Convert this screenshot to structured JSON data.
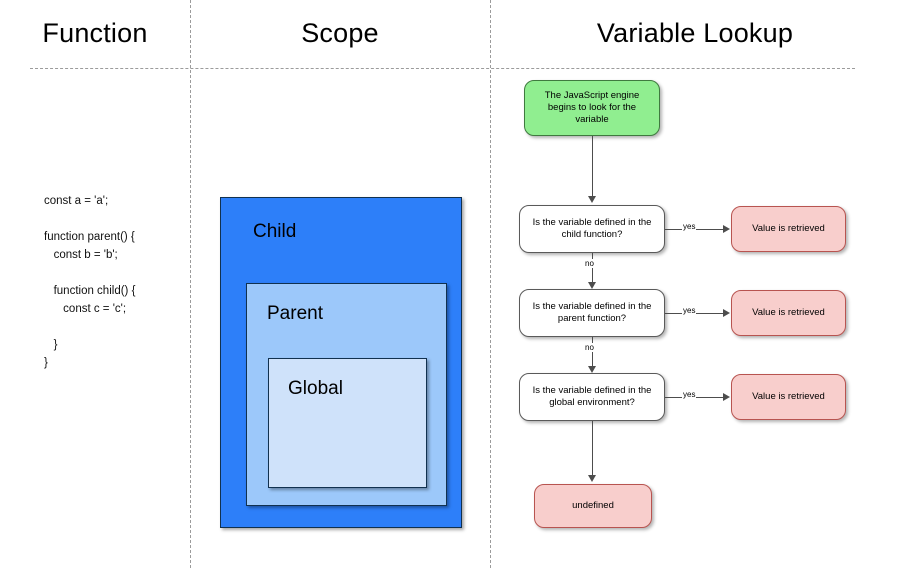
{
  "columns": [
    {
      "id": "function",
      "title": "Function"
    },
    {
      "id": "scope",
      "title": "Scope"
    },
    {
      "id": "lookup",
      "title": "Variable Lookup"
    }
  ],
  "code": {
    "label": "javascript-scope-example",
    "text": "const a = 'a';\n\nfunction parent() {\n   const b = 'b';\n\n   function child() {\n      const c = 'c';\n\n   }\n}"
  },
  "scope_boxes": [
    {
      "id": "child",
      "label": "Child",
      "color": "#2d7ff9"
    },
    {
      "id": "parent",
      "label": "Parent",
      "color": "#9cc8fa"
    },
    {
      "id": "global",
      "label": "Global",
      "color": "#cfe2fa"
    }
  ],
  "flowchart": {
    "start": {
      "id": "start-node",
      "text": "The JavaScript engine begins to look for the variable",
      "color": "#90ee90"
    },
    "decisions": [
      {
        "id": "child-check",
        "text": "Is the variable defined in the child function?",
        "yes_label": "yes",
        "no_label": "no"
      },
      {
        "id": "parent-check",
        "text": "Is the variable defined in the parent function?",
        "yes_label": "yes",
        "no_label": "no"
      },
      {
        "id": "global-check",
        "text": "Is the variable defined in the global environment?",
        "yes_label": "yes",
        "no_label": ""
      }
    ],
    "results": [
      {
        "id": "result-child",
        "text": "Value is retrieved",
        "color": "#f8cecc"
      },
      {
        "id": "result-parent",
        "text": "Value is retrieved",
        "color": "#f8cecc"
      },
      {
        "id": "result-global",
        "text": "Value is retrieved",
        "color": "#f8cecc"
      }
    ],
    "fallback": {
      "id": "undefined-node",
      "text": "undefined",
      "color": "#f8cecc"
    }
  }
}
